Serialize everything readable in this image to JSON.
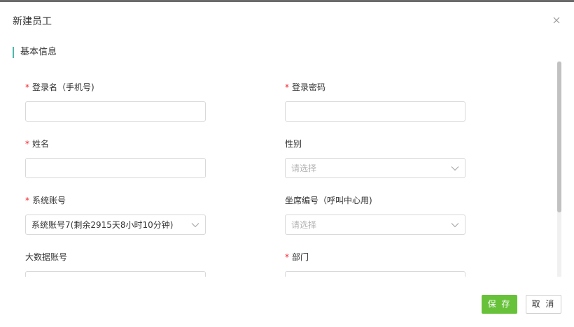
{
  "dialog": {
    "title": "新建员工",
    "close_icon": "close-icon"
  },
  "section": {
    "title": "基本信息"
  },
  "form": {
    "login_name": {
      "label": "登录名（手机号)",
      "required": true,
      "value": ""
    },
    "password": {
      "label": "登录密码",
      "required": true,
      "value": ""
    },
    "name": {
      "label": "姓名",
      "required": true,
      "value": ""
    },
    "gender": {
      "label": "性别",
      "required": false,
      "placeholder": "请选择"
    },
    "system_account": {
      "label": "系统账号",
      "required": true,
      "value": "系统账号7(剩余2915天8小时10分钟)"
    },
    "seat_number": {
      "label": "坐席编号（呼叫中心用)",
      "required": false,
      "placeholder": "请选择"
    },
    "big_data_account": {
      "label": "大数据账号",
      "required": false,
      "value": ""
    },
    "department": {
      "label": "部门",
      "required": true,
      "value": ""
    }
  },
  "footer": {
    "save_label": "保 存",
    "cancel_label": "取 消"
  },
  "colors": {
    "accent": "#4db6ac",
    "save_button": "#67c23a",
    "required_marker": "#f5222d",
    "placeholder": "#b3b3b3"
  }
}
